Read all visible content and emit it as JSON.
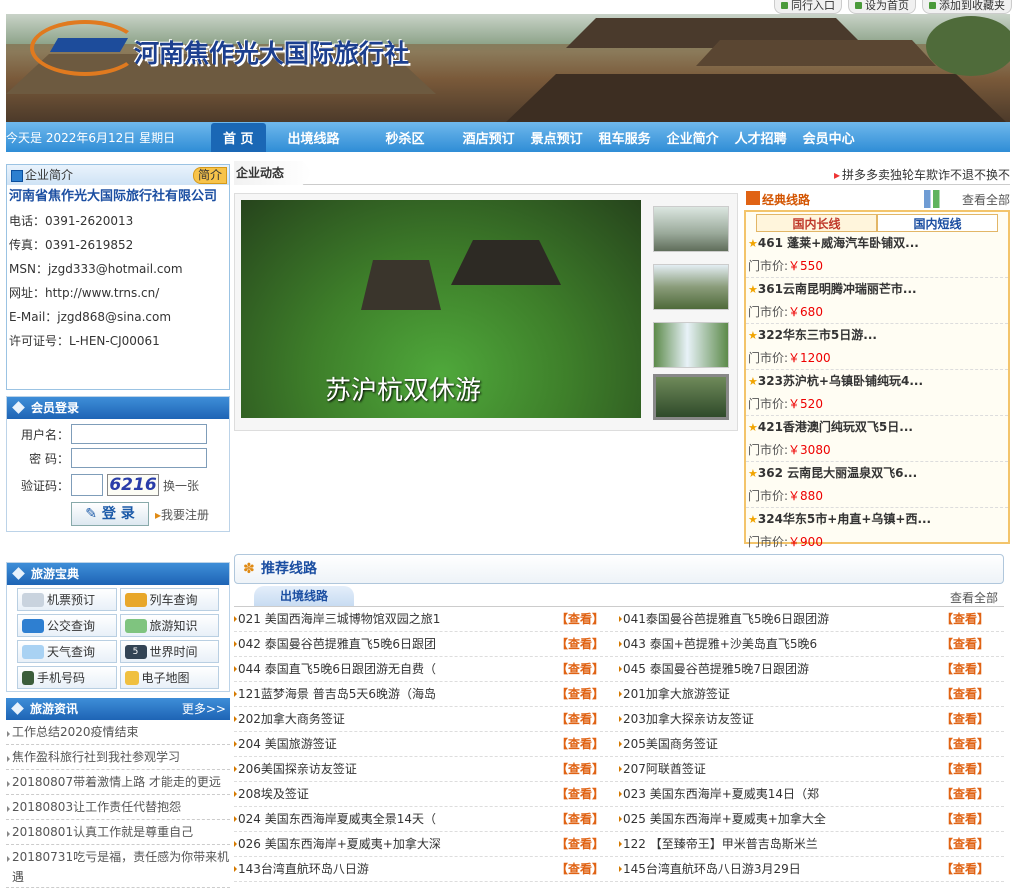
{
  "toplinks": [
    "同行入口",
    "设为首页",
    "添加到收藏夹"
  ],
  "brand": {
    "name": "河南焦作光大国际旅行社"
  },
  "nav": {
    "date": "今天是 2022年6月12日 星期日",
    "items": [
      "首 页",
      "出境线路",
      "秒杀区",
      "酒店预订",
      "景点预订",
      "租车服务",
      "企业简介",
      "人才招聘",
      "会员中心"
    ]
  },
  "company": {
    "header": "企业简介",
    "tag": "简介",
    "name": "河南省焦作光大国际旅行社有限公司",
    "lines": [
      "电话：0391-2620013",
      "传真：0391-2619852",
      "MSN：jzgd333@hotmail.com",
      "网址：http://www.trns.cn/",
      "E-Mail：jzgd868@sina.com",
      "许可证号：L-HEN-CJ00061"
    ]
  },
  "login": {
    "header": "会员登录",
    "user_label": "用户名：",
    "pass_label": "密  码：",
    "code_label": "验证码：",
    "captcha": "6216",
    "refresh": "换一张",
    "submit": "登 录",
    "register": "我要注册"
  },
  "tools": {
    "header": "旅游宝典",
    "items": [
      "机票预订",
      "列车查询",
      "公交查询",
      "旅游知识",
      "天气查询",
      "世界时间",
      "手机号码",
      "电子地图"
    ],
    "icon_date": "5"
  },
  "news": {
    "header": "旅游资讯",
    "more": "更多>>",
    "items": [
      "工作总结2020疫情结束",
      "焦作盈科旅行社到我社参观学习",
      "20180807带着激情上路 才能走的更远",
      "20180803让工作责任代替抱怨",
      "20180801认真工作就是尊重自己",
      "20180731吃亏是福，责任感为你带来机遇"
    ]
  },
  "dynamics": {
    "tab": "企业动态",
    "ticker": "拼多多卖独轮车欺诈不退不换不"
  },
  "slider": {
    "caption": "苏沪杭双休游"
  },
  "classic": {
    "title": "经典线路",
    "more": "查看全部",
    "tabs": [
      "国内长线",
      "国内短线"
    ],
    "price_label": "门市价:",
    "items": [
      {
        "name": "461 蓬莱+威海汽车卧铺双...",
        "price": "￥550"
      },
      {
        "name": "361云南昆明腾冲瑞丽芒市...",
        "price": "￥680"
      },
      {
        "name": "322华东三市5日游...",
        "price": "￥1200"
      },
      {
        "name": "323苏沪杭+乌镇卧铺纯玩4...",
        "price": "￥520"
      },
      {
        "name": "421香港澳门纯玩双飞5日...",
        "price": "￥3080"
      },
      {
        "name": "362 云南昆大丽温泉双飞6...",
        "price": "￥880"
      },
      {
        "name": "324华东5市+甪直+乌镇+西...",
        "price": "￥900"
      }
    ]
  },
  "recommend": {
    "title": "推荐线路",
    "subtab": "出境线路",
    "more": "查看全部",
    "view": "【查看】",
    "rows": [
      [
        "021 美国西海岸三城博物馆双园之旅1",
        "041泰国曼谷芭提雅直飞5晚6日跟团游"
      ],
      [
        "042 泰国曼谷芭提雅直飞5晚6日跟团",
        "043 泰国+芭提雅+沙美岛直飞5晚6"
      ],
      [
        "044 泰国直飞5晚6日跟团游无自费（",
        "045 泰国曼谷芭提雅5晚7日跟团游"
      ],
      [
        "121蓝梦海景 普吉岛5天6晚游（海岛",
        "201加拿大旅游签证"
      ],
      [
        "202加拿大商务签证",
        "203加拿大探亲访友签证"
      ],
      [
        "204 美国旅游签证",
        "205美国商务签证"
      ],
      [
        "206美国探亲访友签证",
        "207阿联酋签证"
      ],
      [
        "208埃及签证",
        "023 美国东西海岸+夏威夷14日（郑"
      ],
      [
        "024 美国东西海岸夏威夷全景14天（",
        "025 美国东西海岸+夏威夷+加拿大全"
      ],
      [
        "026 美国东西海岸+夏威夷+加拿大深",
        "122 【至臻帝王】甲米普吉岛斯米兰"
      ],
      [
        "143台湾直航环岛八日游",
        "145台湾直航环岛八日游3月29日"
      ]
    ]
  },
  "colors": {
    "nav": "#2f8dd6",
    "accent": "#e06314",
    "link": "#1c4fa2"
  }
}
